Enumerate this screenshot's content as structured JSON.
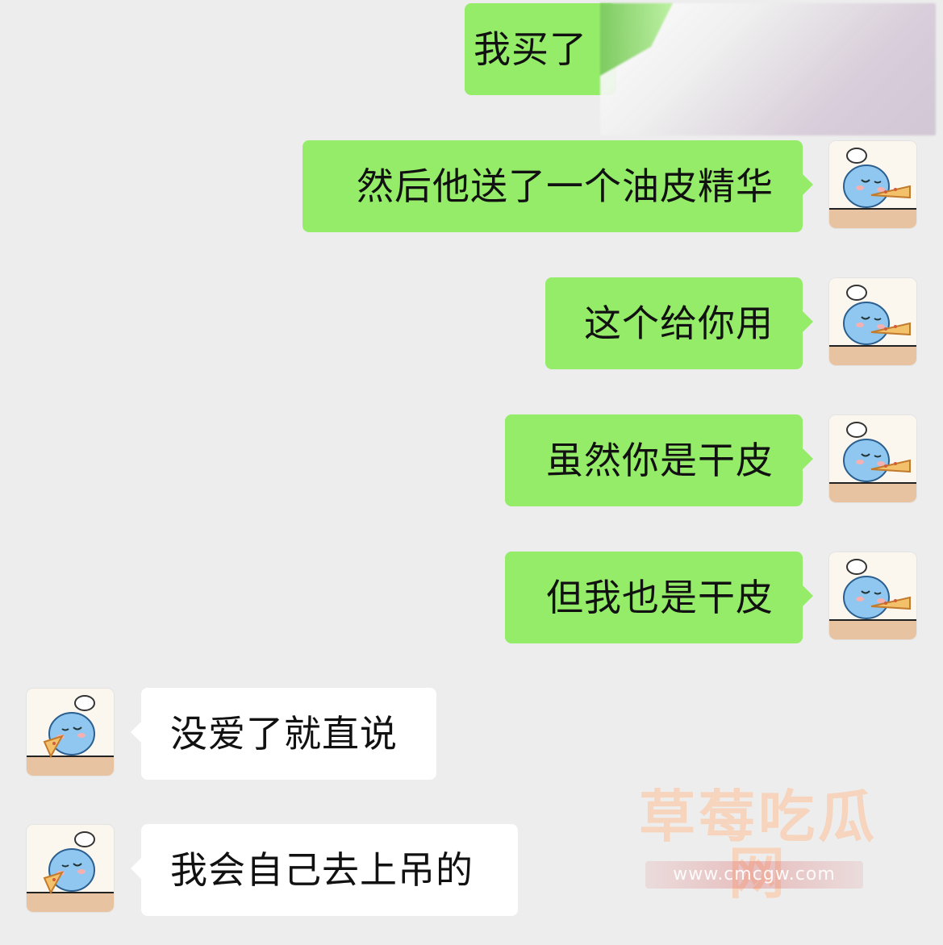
{
  "messages": [
    {
      "text": "我买了",
      "side": "sent",
      "avatar": "pizza-cat-avatar",
      "avatar_visible": false
    },
    {
      "text": "然后他送了一个油皮精华",
      "side": "sent",
      "avatar": "pizza-cat-avatar"
    },
    {
      "text": "这个给你用",
      "side": "sent",
      "avatar": "pizza-cat-avatar"
    },
    {
      "text": "虽然你是干皮",
      "side": "sent",
      "avatar": "pizza-cat-avatar"
    },
    {
      "text": "但我也是干皮",
      "side": "sent",
      "avatar": "pizza-cat-avatar"
    },
    {
      "text": "没爱了就直说",
      "side": "received",
      "avatar": "pizza-cat-avatar"
    },
    {
      "text": "我会自己去上吊的",
      "side": "received",
      "avatar": "pizza-cat-avatar"
    }
  ],
  "watermark": {
    "title": "草莓吃瓜网",
    "url": "www.cmcgw.com"
  },
  "colors": {
    "background": "#ededed",
    "sent_bubble": "#95ec69",
    "received_bubble": "#ffffff",
    "text": "#111111"
  },
  "icons": {
    "avatar": "pizza-cat-avatar"
  }
}
